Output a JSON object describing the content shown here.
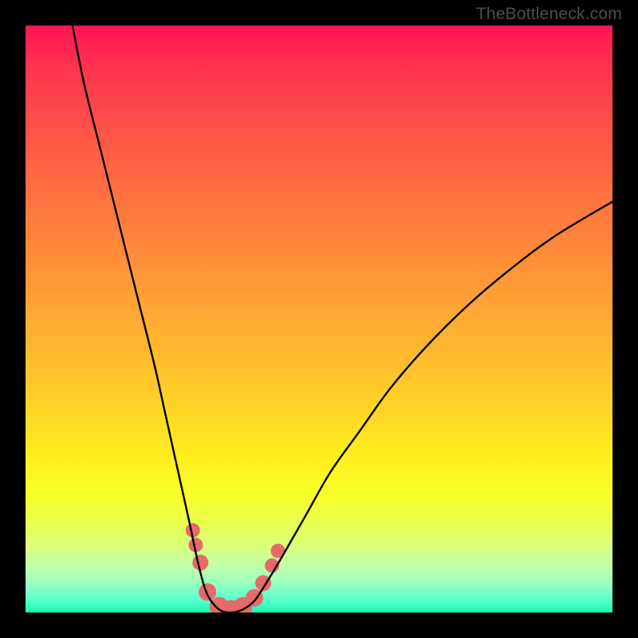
{
  "watermark": {
    "text": "TheBottleneck.com"
  },
  "chart_data": {
    "type": "line",
    "title": "",
    "xlabel": "",
    "ylabel": "",
    "xlim": [
      0,
      100
    ],
    "ylim": [
      0,
      100
    ],
    "series": [
      {
        "name": "bottleneck-curve",
        "x": [
          8,
          10,
          13,
          16,
          19,
          22,
          24,
          26,
          28,
          29.5,
          31,
          33,
          35,
          37,
          39,
          41,
          44,
          48,
          52,
          57,
          62,
          68,
          75,
          82,
          90,
          100
        ],
        "y": [
          100,
          90,
          78,
          66,
          54,
          42,
          33,
          24,
          15,
          8,
          3,
          0.5,
          0,
          0.5,
          2,
          5,
          10,
          17,
          24,
          31,
          38,
          45,
          52,
          58,
          64,
          70
        ]
      }
    ],
    "markers": {
      "name": "highlight-dots",
      "color": "#e66a6a",
      "points": [
        {
          "x": 28.5,
          "y": 14,
          "r": 9
        },
        {
          "x": 29.0,
          "y": 11.5,
          "r": 9
        },
        {
          "x": 29.8,
          "y": 8.5,
          "r": 10
        },
        {
          "x": 31.0,
          "y": 3.5,
          "r": 11
        },
        {
          "x": 33.0,
          "y": 1.0,
          "r": 12
        },
        {
          "x": 35.0,
          "y": 0.5,
          "r": 12
        },
        {
          "x": 37.0,
          "y": 1.0,
          "r": 12
        },
        {
          "x": 39.0,
          "y": 2.5,
          "r": 11
        },
        {
          "x": 40.5,
          "y": 5.0,
          "r": 10
        },
        {
          "x": 42.0,
          "y": 8.0,
          "r": 9
        },
        {
          "x": 43.0,
          "y": 10.5,
          "r": 9
        }
      ]
    }
  }
}
